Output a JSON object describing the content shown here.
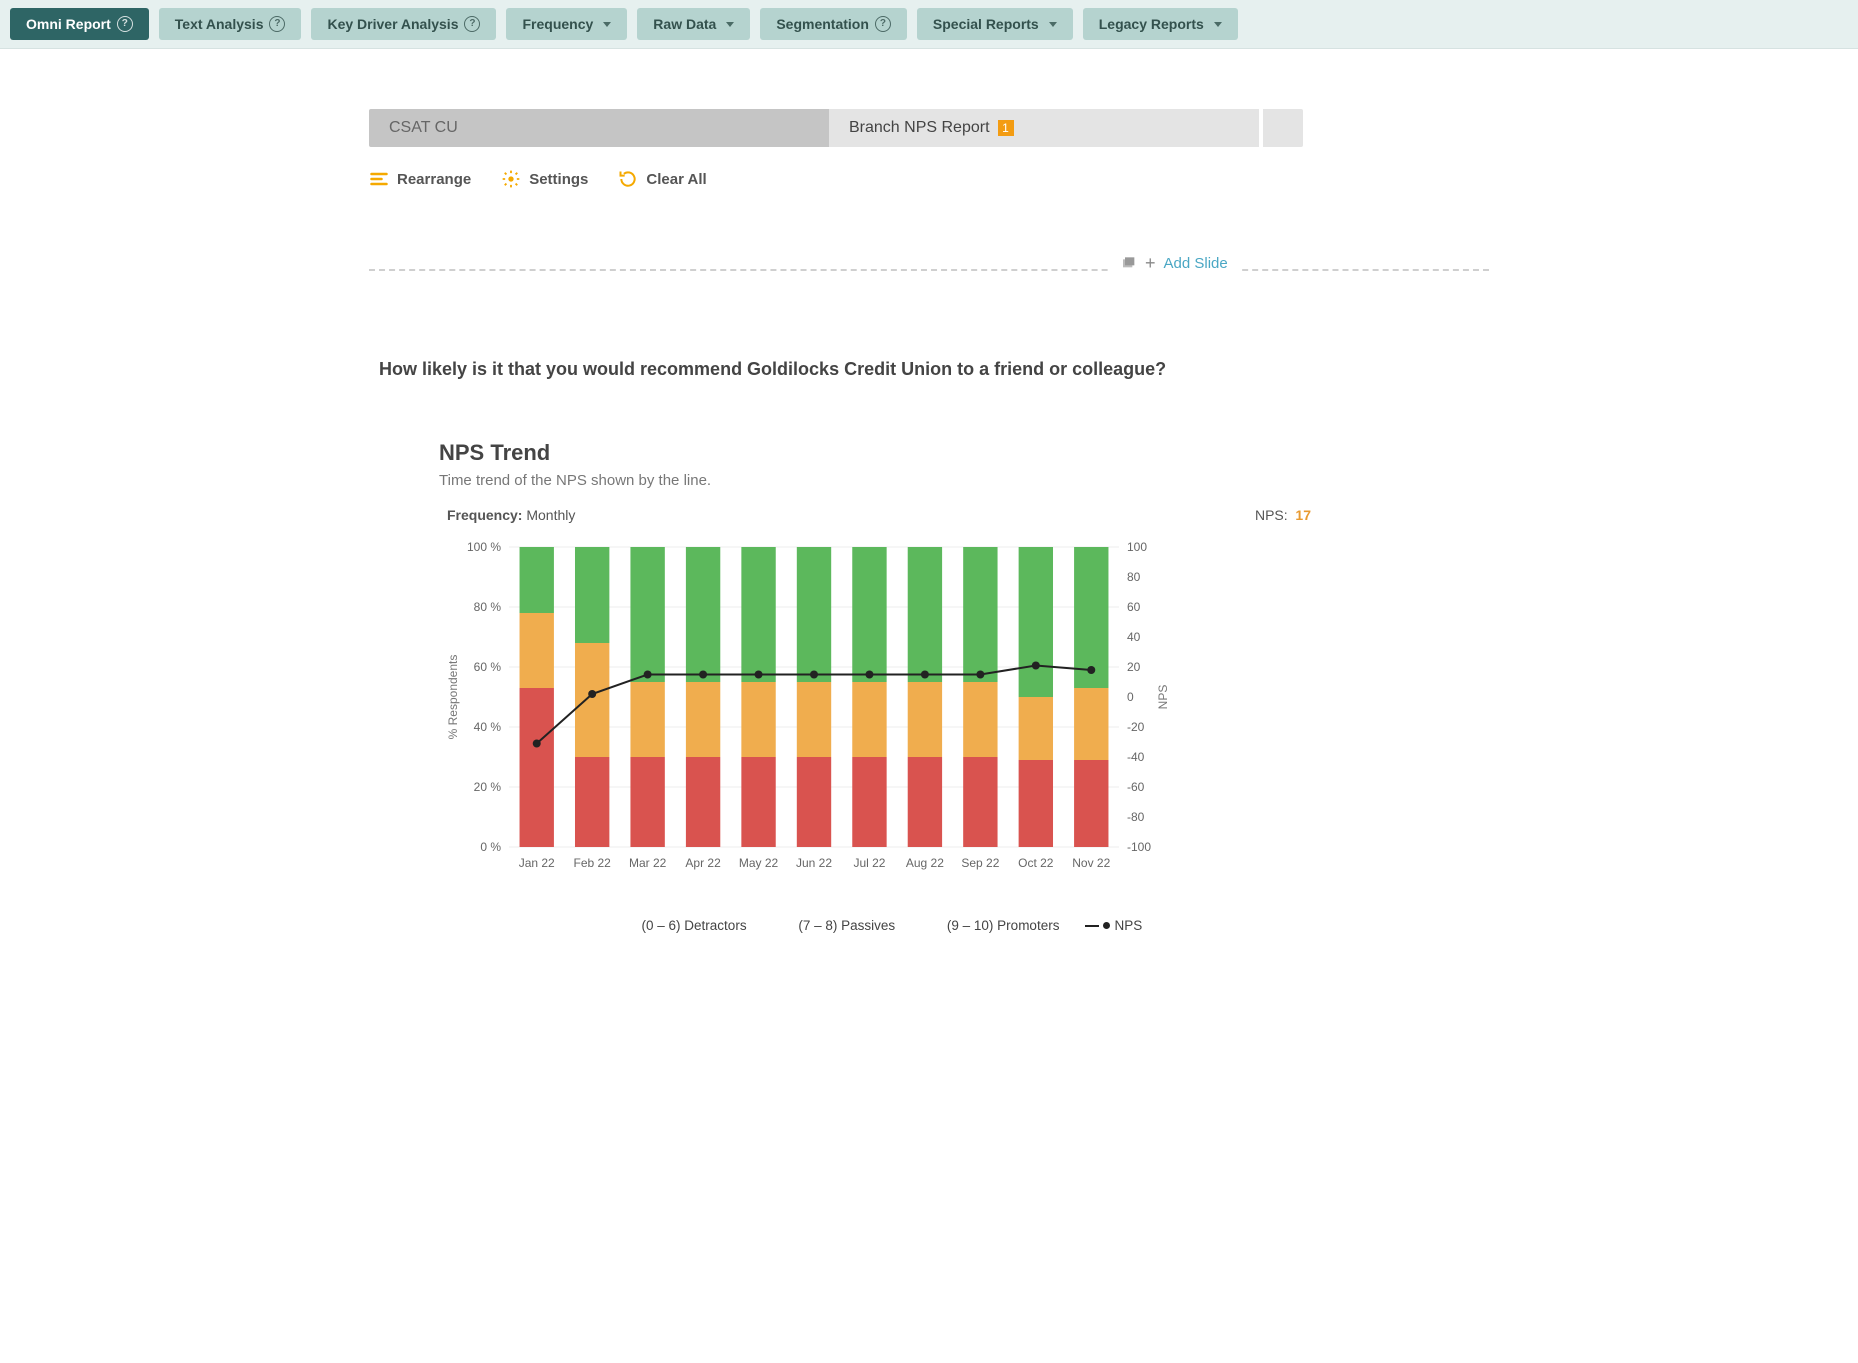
{
  "nav": {
    "items": [
      {
        "label": "Omni Report",
        "help": true
      },
      {
        "label": "Text Analysis",
        "help": true
      },
      {
        "label": "Key Driver Analysis",
        "help": true
      },
      {
        "label": "Frequency",
        "caret": true
      },
      {
        "label": "Raw Data",
        "caret": true
      },
      {
        "label": "Segmentation",
        "help": true
      },
      {
        "label": "Special Reports",
        "caret": true
      },
      {
        "label": "Legacy Reports",
        "caret": true
      }
    ]
  },
  "breadcrumb": {
    "a": "CSAT CU",
    "b": "Branch NPS Report",
    "badge": "1"
  },
  "toolbar": {
    "rearrange": "Rearrange",
    "settings": "Settings",
    "clear": "Clear All"
  },
  "add_slide": "Add Slide",
  "question": "How likely is it that you would recommend Goldilocks Credit Union to a friend or colleague?",
  "chart": {
    "title": "NPS Trend",
    "subtitle": "Time trend of the NPS shown by the line.",
    "freq_label": "Frequency:",
    "freq_value": "Monthly",
    "nps_label": "NPS:",
    "nps_value": "17",
    "y_axis_label": "% Respondents",
    "y2_axis_label": "NPS",
    "legend": {
      "det": "(0 – 6) Detractors",
      "pas": "(7 – 8) Passives",
      "pro": "(9 – 10) Promoters",
      "nps": "NPS"
    }
  },
  "chart_data": {
    "type": "bar+line",
    "title": "NPS Trend",
    "xlabel": "",
    "ylabel": "% Respondents",
    "ylim": [
      0,
      100
    ],
    "y2label": "NPS",
    "y2lim": [
      -100,
      100
    ],
    "categories": [
      "Jan 22",
      "Feb 22",
      "Mar 22",
      "Apr 22",
      "May 22",
      "Jun 22",
      "Jul 22",
      "Aug 22",
      "Sep 22",
      "Oct 22",
      "Nov 22"
    ],
    "series": [
      {
        "name": "(0 – 6) Detractors",
        "stack": "pct",
        "values": [
          53,
          30,
          30,
          30,
          30,
          30,
          30,
          30,
          30,
          29,
          29
        ]
      },
      {
        "name": "(7 – 8) Passives",
        "stack": "pct",
        "values": [
          25,
          38,
          25,
          25,
          25,
          25,
          25,
          25,
          25,
          21,
          24
        ]
      },
      {
        "name": "(9 – 10) Promoters",
        "stack": "pct",
        "values": [
          22,
          32,
          45,
          45,
          45,
          45,
          45,
          45,
          45,
          50,
          47
        ]
      },
      {
        "name": "NPS",
        "axis": "y2",
        "type": "line",
        "values": [
          -31,
          2,
          15,
          15,
          15,
          15,
          15,
          15,
          15,
          21,
          18
        ]
      }
    ],
    "y_ticks": [
      0,
      20,
      40,
      60,
      80,
      100
    ],
    "y2_ticks": [
      -100,
      -80,
      -60,
      -40,
      -20,
      0,
      20,
      40,
      60,
      80,
      100
    ]
  }
}
